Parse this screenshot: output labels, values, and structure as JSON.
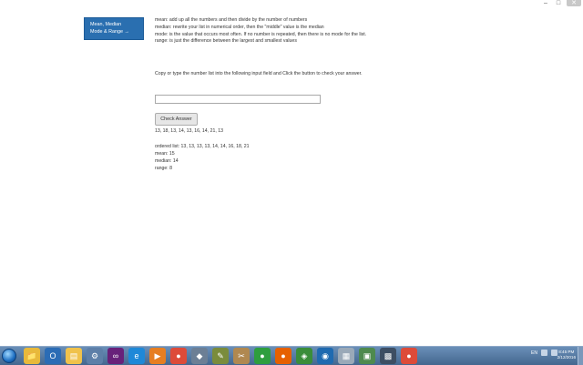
{
  "sidebar": {
    "line1": "Mean, Median",
    "line2": "Mode & Range →"
  },
  "content": {
    "mean": "mean: add up all the numbers and then divide by the number of numbers",
    "median": "median: rewrite your list in numerical order, then the \"middle\" value is the median",
    "mode": "mode: is the value that occurs most often. If no number is repeated, then there is no mode for the list.",
    "range": "range: is just the difference between the largest and smallest values",
    "instructions": "Copy or type the number list into the following input field and Click the button to check your answer.",
    "input_value": "",
    "button_label": "Check Answer",
    "echo": "13, 18, 13, 14, 13, 16, 14, 21, 13"
  },
  "results": {
    "ordered": "ordered list: 13, 13, 13, 13, 14, 14, 16, 18, 21",
    "mean": "mean: 15",
    "median": "median: 14",
    "range": "range: 8"
  },
  "taskbar": {
    "icons": [
      {
        "name": "windows-explorer-icon",
        "glyph": "📁",
        "color": "#e8b93b"
      },
      {
        "name": "outlook-icon",
        "glyph": "O",
        "color": "#2b6cb5"
      },
      {
        "name": "folder-icon",
        "glyph": "▤",
        "color": "#f0c24b"
      },
      {
        "name": "settings-icon",
        "glyph": "⚙",
        "color": "#5d7fa8"
      },
      {
        "name": "visual-studio-icon",
        "glyph": "∞",
        "color": "#68217a"
      },
      {
        "name": "ie-icon",
        "glyph": "e",
        "color": "#1e88d8"
      },
      {
        "name": "media-player-icon",
        "glyph": "▶",
        "color": "#e67e22"
      },
      {
        "name": "chrome-icon",
        "glyph": "●",
        "color": "#dd4b39"
      },
      {
        "name": "elephant-icon",
        "glyph": "◆",
        "color": "#6c7f95"
      },
      {
        "name": "tool-icon",
        "glyph": "✎",
        "color": "#7a8c3c"
      },
      {
        "name": "tools-icon",
        "glyph": "✂",
        "color": "#b08850"
      },
      {
        "name": "green-app-icon",
        "glyph": "●",
        "color": "#2e9e3e"
      },
      {
        "name": "firefox-icon",
        "glyph": "●",
        "color": "#e66000"
      },
      {
        "name": "arcgis-icon",
        "glyph": "◈",
        "color": "#3a8d3a"
      },
      {
        "name": "globe-icon",
        "glyph": "◉",
        "color": "#1f6ab0"
      },
      {
        "name": "notepad-icon",
        "glyph": "▦",
        "color": "#9aa9b8"
      },
      {
        "name": "terminal-icon",
        "glyph": "▣",
        "color": "#4e8a4e"
      },
      {
        "name": "app-grid-icon",
        "glyph": "▩",
        "color": "#3d4e63"
      },
      {
        "name": "chrome-icon-2",
        "glyph": "●",
        "color": "#dd4b39"
      }
    ],
    "tray_label": "EN",
    "time": "8:45 PM",
    "date": "2/12/2016"
  }
}
